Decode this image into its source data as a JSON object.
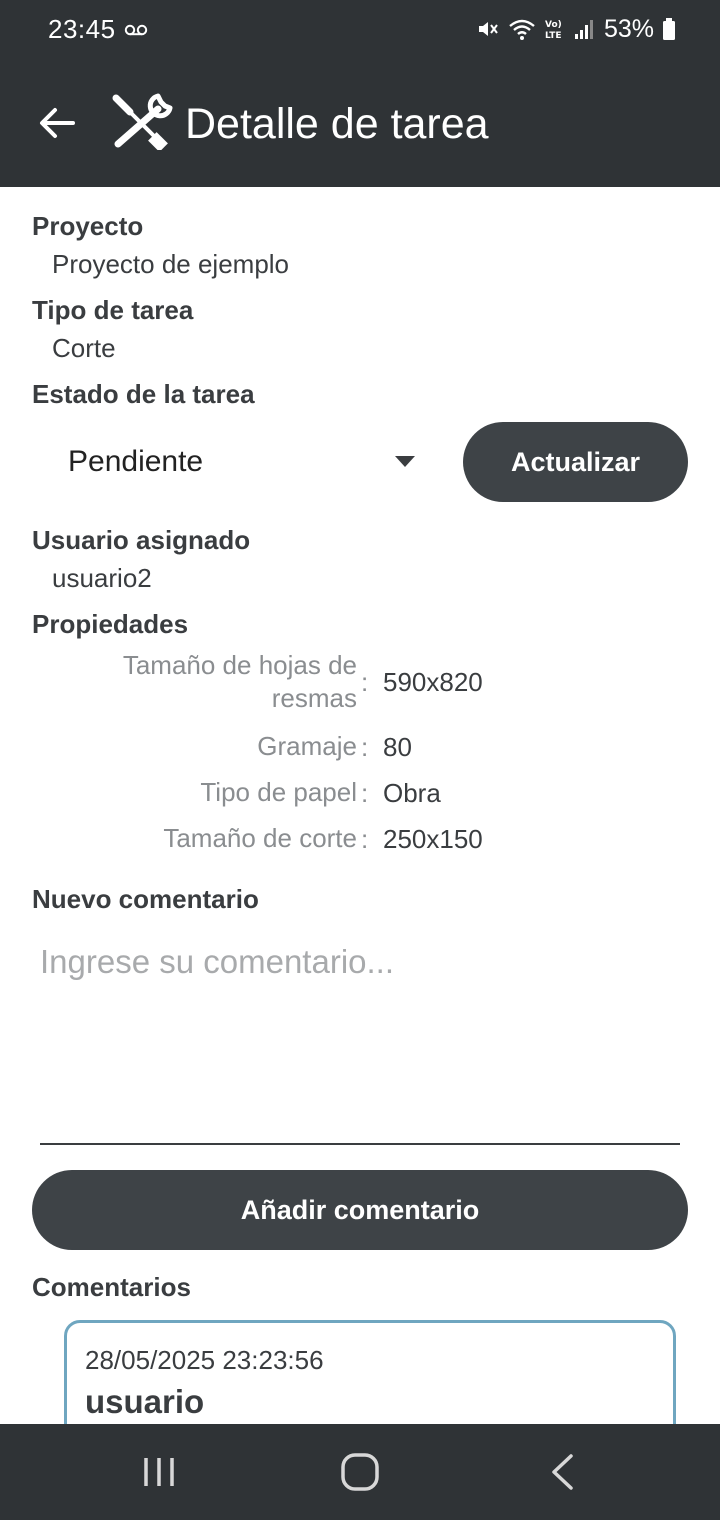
{
  "status_bar": {
    "time": "23:45",
    "battery": "53%",
    "icons": [
      "voicemail-icon",
      "mute-icon",
      "wifi-icon",
      "volte-icon",
      "signal-icon",
      "battery-icon"
    ]
  },
  "app_bar": {
    "title": "Detalle de tarea",
    "icons": [
      "back-arrow-icon",
      "tools-icon"
    ]
  },
  "task": {
    "project_label": "Proyecto",
    "project_value": "Proyecto de ejemplo",
    "type_label": "Tipo de tarea",
    "type_value": "Corte",
    "status_label": "Estado de la tarea",
    "status_selected": "Pendiente",
    "update_button": "Actualizar",
    "assigned_label": "Usuario asignado",
    "assigned_value": "usuario2",
    "properties_label": "Propiedades",
    "properties": [
      {
        "key_line1": "Tamaño de hojas de",
        "key_line2": "resmas",
        "value": "590x820"
      },
      {
        "key": "Gramaje",
        "value": "80"
      },
      {
        "key": "Tipo de papel",
        "value": "Obra"
      },
      {
        "key": "Tamaño de corte",
        "value": "250x150"
      }
    ]
  },
  "new_comment": {
    "label": "Nuevo comentario",
    "placeholder": "Ingrese su comentario...",
    "value": "",
    "add_button": "Añadir comentario"
  },
  "comments": {
    "label": "Comentarios",
    "items": [
      {
        "date": "28/05/2025 23:23:56",
        "user": "usuario"
      }
    ]
  },
  "colors": {
    "bars": "#2f3336",
    "button": "#3e4347",
    "card_border": "#6fa6c0",
    "secondary_text": "#8a8d90"
  },
  "nav_bar": {
    "icons": [
      "recent-apps-icon",
      "home-icon",
      "back-icon"
    ]
  }
}
